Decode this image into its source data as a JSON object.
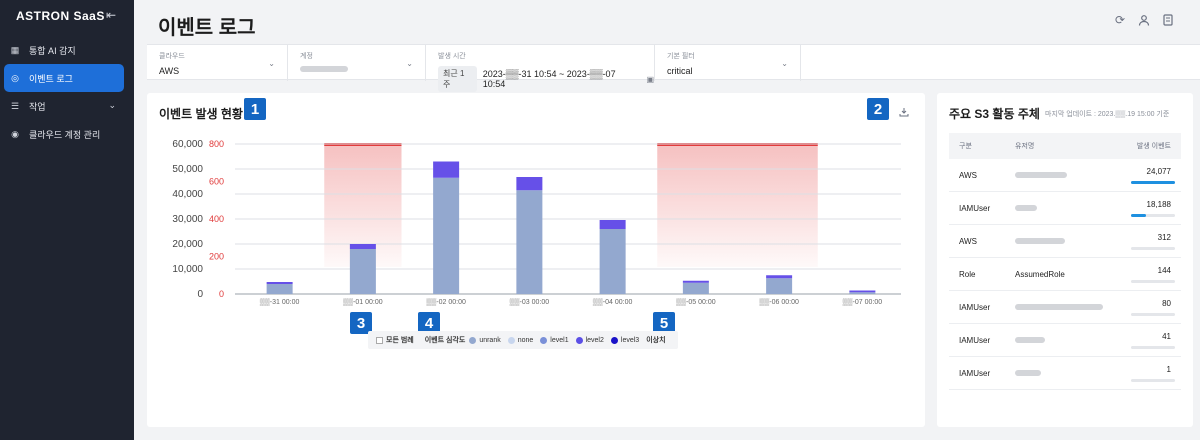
{
  "app": {
    "brand": "ASTRON SaaS"
  },
  "sidebar": {
    "items": [
      {
        "label": "통합 AI 감지",
        "icon": "grid-icon",
        "active": false
      },
      {
        "label": "이벤트 로그",
        "icon": "log-icon",
        "active": true
      },
      {
        "label": "작업",
        "icon": "list-icon",
        "active": false,
        "has_children": true
      },
      {
        "label": "클라우드 계정 관리",
        "icon": "target-icon",
        "active": false
      }
    ]
  },
  "header": {
    "title": "이벤트 로그"
  },
  "filters": {
    "cloud": {
      "label": "클라우드",
      "value": "AWS"
    },
    "account": {
      "label": "계정",
      "value": ""
    },
    "time": {
      "label": "발생 시간",
      "preset": "최근 1주",
      "range": "2023-▒▒-31 10:54 ~ 2023-▒▒-07 10:54"
    },
    "basic_filter": {
      "label": "기본 필터",
      "value": "critical"
    }
  },
  "event_panel": {
    "title": "이벤트 발생 현황",
    "markers": [
      "1",
      "2",
      "3",
      "4",
      "5"
    ]
  },
  "legend": {
    "all_label": "모든 범례",
    "severity_label": "이벤트 심각도",
    "items": [
      {
        "name": "unrank",
        "color": "#93a8cf"
      },
      {
        "name": "none",
        "color": "#c8d6ee"
      },
      {
        "name": "level1",
        "color": "#7a90d8"
      },
      {
        "name": "level2",
        "color": "#5b4fe6"
      },
      {
        "name": "level3",
        "color": "#1a12c8"
      }
    ],
    "anomaly_label": "이상치"
  },
  "chart_data": {
    "type": "bar",
    "stacked": true,
    "categories": [
      "▒▒-31 00:00",
      "▒▒-01 00:00",
      "▒▒-02 00:00",
      "▒▒-03 00:00",
      "▒▒-04 00:00",
      "▒▒-05 00:00",
      "▒▒-06 00:00",
      "▒▒-07 00:00"
    ],
    "series": [
      {
        "name": "unrank",
        "color": "#93a8cf",
        "values": [
          4000,
          18000,
          46500,
          41500,
          26000,
          4500,
          6300,
          700
        ]
      },
      {
        "name": "level2",
        "color": "#6650e8",
        "values": [
          800,
          2000,
          6500,
          5300,
          3600,
          800,
          1200,
          700
        ]
      }
    ],
    "ylim": [
      0,
      60000
    ],
    "yticks": [
      "0",
      "10,000",
      "20,000",
      "30,000",
      "40,000",
      "50,000",
      "60,000"
    ],
    "y2ticks": [
      "0",
      "200",
      "400",
      "600",
      "800"
    ],
    "anomaly_ranges": [
      [
        1,
        1
      ],
      [
        5,
        6
      ]
    ],
    "anomaly_color": "#e23b3b",
    "grid": true
  },
  "s3_panel": {
    "title": "주요 S3 활동 주체",
    "updated": "마지막 업데이트 : 2023.▒▒.19 15:00 기준",
    "columns": [
      "구분",
      "유저명",
      "발생 이벤트"
    ],
    "rows": [
      {
        "type": "AWS",
        "user": "",
        "count": "24,077",
        "ratio": 1.0
      },
      {
        "type": "IAMUser",
        "user": "",
        "count": "18,188",
        "ratio": 0.33
      },
      {
        "type": "AWS",
        "user": "",
        "count": "312",
        "ratio": 0.0
      },
      {
        "type": "Role",
        "user": "AssumedRole",
        "count": "144",
        "ratio": 0.0
      },
      {
        "type": "IAMUser",
        "user": "",
        "count": "80",
        "ratio": 0.0
      },
      {
        "type": "IAMUser",
        "user": "",
        "count": "41",
        "ratio": 0.0
      },
      {
        "type": "IAMUser",
        "user": "",
        "count": "1",
        "ratio": 0.0
      }
    ]
  }
}
